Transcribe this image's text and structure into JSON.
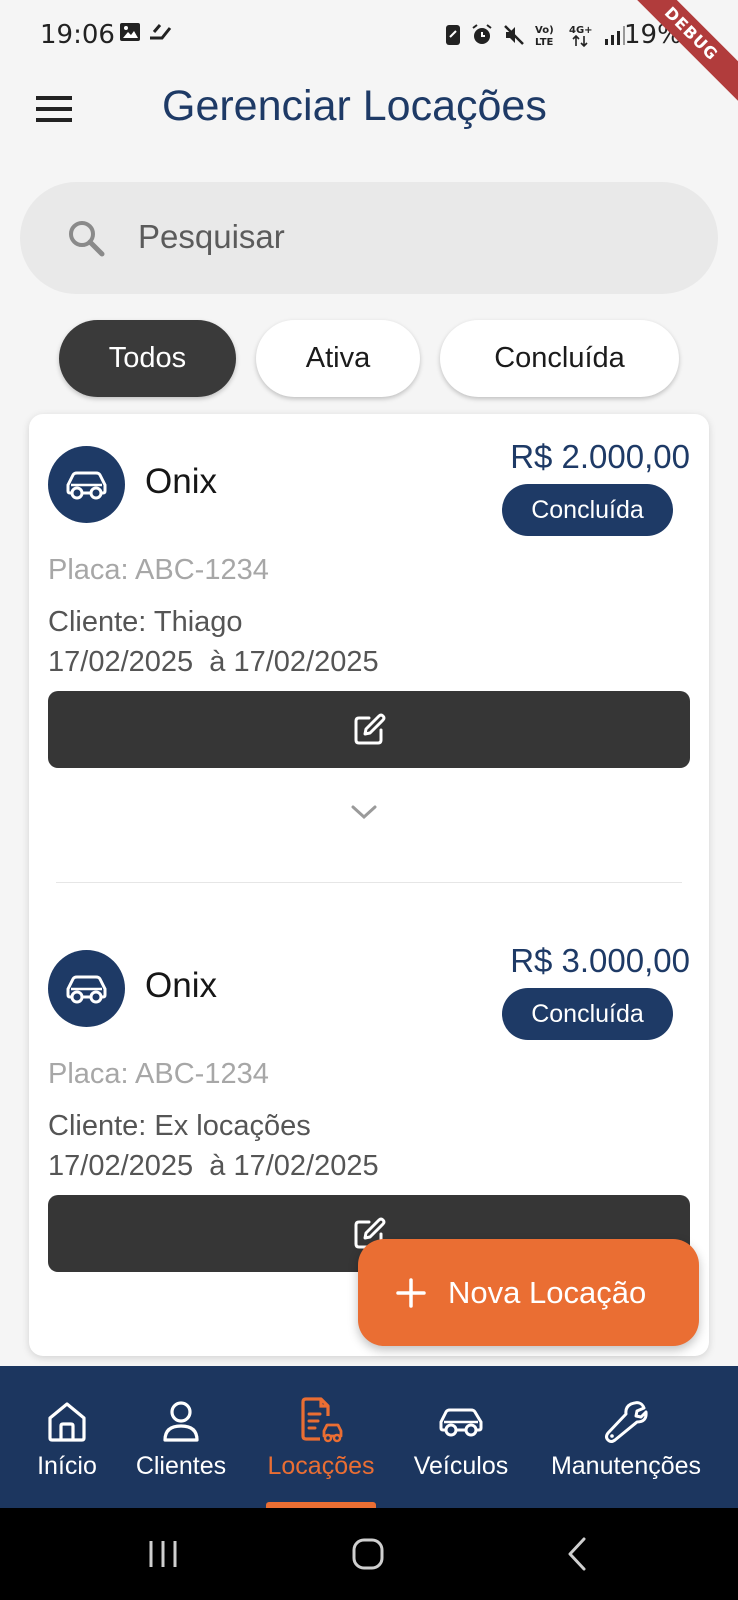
{
  "status_bar": {
    "time": "19:06",
    "battery": "19%",
    "left_icons": [
      "image-icon",
      "signal-app-icon"
    ],
    "right_icons": [
      "nfc-icon",
      "alarm-icon",
      "mute-icon",
      "volte-icon",
      "4g-icon",
      "signal-icon"
    ],
    "debug_banner": "DEBUG"
  },
  "app_bar": {
    "title": "Gerenciar Locações",
    "menu_icon": "menu-icon"
  },
  "search": {
    "placeholder": "Pesquisar"
  },
  "filters": [
    {
      "label": "Todos",
      "active": true
    },
    {
      "label": "Ativa",
      "active": false
    },
    {
      "label": "Concluída",
      "active": false
    }
  ],
  "rentals": [
    {
      "vehicle": "Onix",
      "price": "R$ 2.000,00",
      "status": "Concluída",
      "plate": "Placa: ABC-1234",
      "client": "Cliente: Thiago",
      "dates": "17/02/2025  à 17/02/2025"
    },
    {
      "vehicle": "Onix",
      "price": "R$ 3.000,00",
      "status": "Concluída",
      "plate": "Placa: ABC-1234",
      "client": "Cliente: Ex locações",
      "dates": "17/02/2025  à 17/02/2025"
    }
  ],
  "fab": {
    "label": "Nova Locação"
  },
  "bottom_nav": [
    {
      "label": "Início",
      "icon": "home-icon",
      "active": false
    },
    {
      "label": "Clientes",
      "icon": "person-icon",
      "active": false
    },
    {
      "label": "Locações",
      "icon": "rental-document-icon",
      "active": true
    },
    {
      "label": "Veículos",
      "icon": "car-icon",
      "active": false
    },
    {
      "label": "Manutenções",
      "icon": "wrench-icon",
      "active": false
    }
  ],
  "colors": {
    "primary": "#1e3a66",
    "accent": "#ea6e33",
    "dark_button": "#363636",
    "background": "#f5f5f5"
  }
}
